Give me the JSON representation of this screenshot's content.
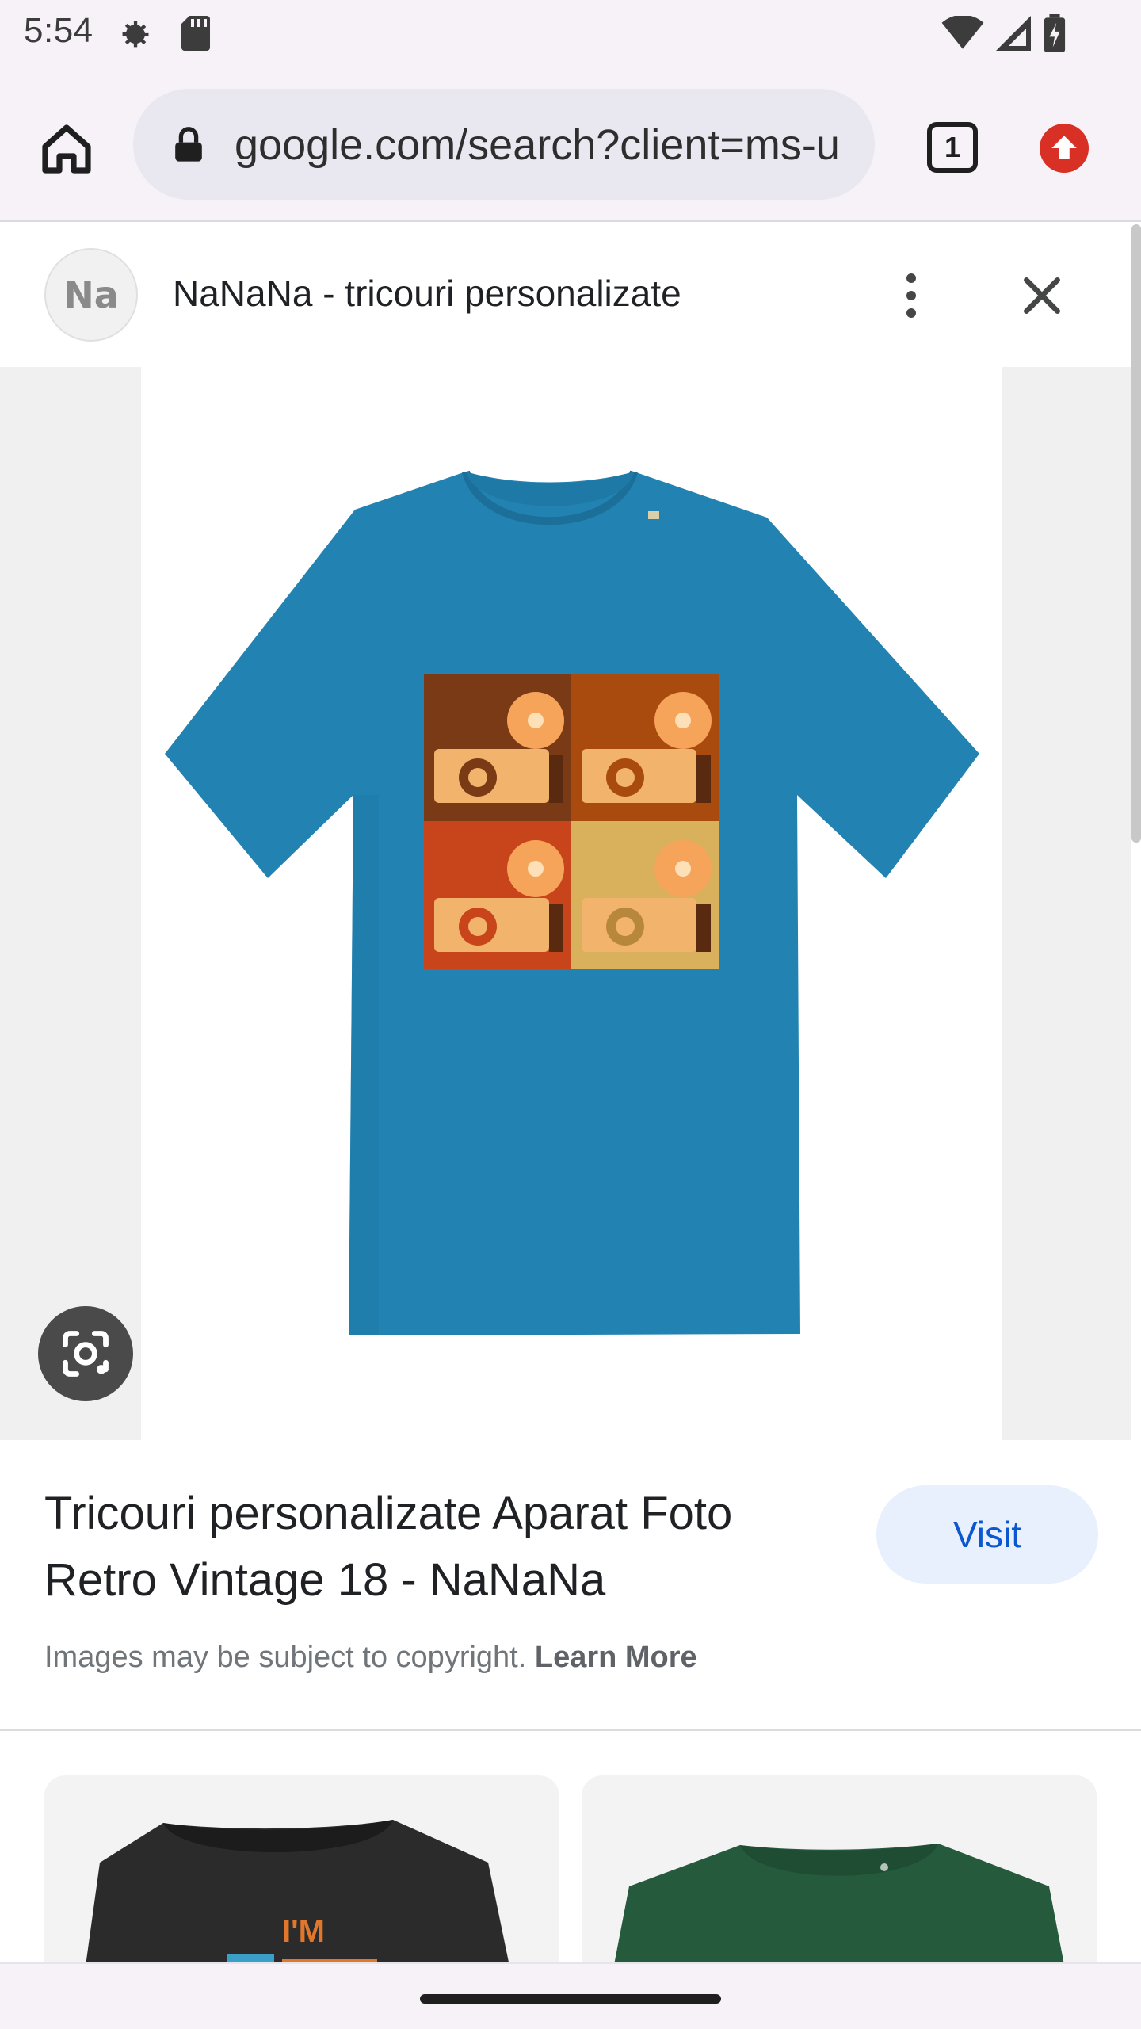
{
  "status_bar": {
    "time": "5:54"
  },
  "browser": {
    "url": "google.com/search?client=ms-u",
    "tab_count": "1"
  },
  "panel": {
    "site_avatar_text": "Na",
    "site_name": "NaNaNa - tricouri personalizate"
  },
  "result": {
    "title": "Tricouri personalizate Aparat Foto Retro Vintage 18 - NaNaNa",
    "visit_label": "Visit",
    "copyright_text": "Images may be subject to copyright.",
    "learn_more_label": "Learn More"
  },
  "related": {
    "left_card_text": "I'M"
  },
  "colors": {
    "shirt_blue": "#2283b3",
    "accent_blue": "#0b57d0",
    "update_red": "#d93025"
  }
}
